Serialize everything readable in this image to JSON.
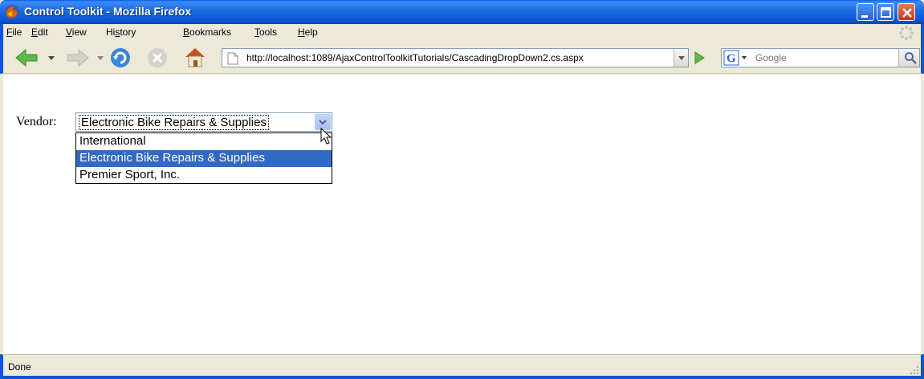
{
  "window": {
    "title": "Control Toolkit - Mozilla Firefox",
    "app_icon": "firefox-icon",
    "colors": {
      "titlebar": "#0b55d6",
      "close": "#c43a17"
    }
  },
  "menu": {
    "items": [
      {
        "label": "File",
        "u": "F",
        "rest": "ile"
      },
      {
        "label": "Edit",
        "u": "E",
        "rest": "dit"
      },
      {
        "label": "View",
        "u": "V",
        "rest": "iew"
      },
      {
        "label": "History",
        "pre": "Hi",
        "u": "s",
        "rest": "tory"
      },
      {
        "label": "Bookmarks",
        "u": "B",
        "rest": "ookmarks"
      },
      {
        "label": "Tools",
        "u": "T",
        "rest": "ools"
      },
      {
        "label": "Help",
        "u": "H",
        "rest": "elp"
      }
    ]
  },
  "toolbar": {
    "buttons": [
      "back-icon",
      "forward-icon",
      "reload-icon",
      "stop-icon",
      "home-icon"
    ],
    "url": "http://localhost:1089/AjaxControlToolkitTutorials/CascadingDropDown2.cs.aspx",
    "search_placeholder": "Google",
    "search_engine_icon": "google-icon"
  },
  "page": {
    "vendor_label": "Vendor:",
    "selected_vendor": "Electronic Bike Repairs & Supplies",
    "options": [
      "International",
      "Electronic Bike Repairs & Supplies",
      "Premier Sport, Inc."
    ],
    "highlighted_index": 1,
    "highlight_color": "#316ac5"
  },
  "status": {
    "text": "Done"
  }
}
